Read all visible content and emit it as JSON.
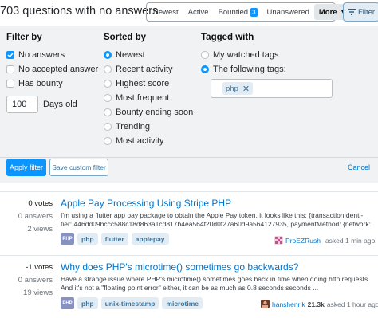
{
  "header": {
    "title": "703 questions with no answers",
    "tabs": [
      {
        "label": "Newest",
        "active": false
      },
      {
        "label": "Active",
        "active": false
      },
      {
        "label": "Bountied",
        "badge": "3",
        "active": false
      },
      {
        "label": "Unanswered",
        "active": false
      },
      {
        "label": "More",
        "active": true
      }
    ],
    "filter_label": "Filter"
  },
  "filter_by": {
    "heading": "Filter by",
    "options": [
      {
        "label": "No answers",
        "checked": true
      },
      {
        "label": "No accepted answer",
        "checked": false
      },
      {
        "label": "Has bounty",
        "checked": false
      }
    ],
    "days_value": "100",
    "days_label": "Days old"
  },
  "sorted_by": {
    "heading": "Sorted by",
    "options": [
      {
        "label": "Newest",
        "selected": true
      },
      {
        "label": "Recent activity",
        "selected": false
      },
      {
        "label": "Highest score",
        "selected": false
      },
      {
        "label": "Most frequent",
        "selected": false
      },
      {
        "label": "Bounty ending soon",
        "selected": false
      },
      {
        "label": "Trending",
        "selected": false
      },
      {
        "label": "Most activity",
        "selected": false
      }
    ]
  },
  "tagged_with": {
    "heading": "Tagged with",
    "options": [
      {
        "label": "My watched tags",
        "selected": false
      },
      {
        "label": "The following tags:",
        "selected": true
      }
    ],
    "tags": [
      "php"
    ]
  },
  "actions": {
    "apply": "Apply filter",
    "save": "Save custom filter",
    "cancel": "Cancel"
  },
  "questions": [
    {
      "votes": "0 votes",
      "answers": "0 answers",
      "views": "2 views",
      "title": "Apple Pay Processing Using Stripe PHP",
      "excerpt": "I'm using a flutter app pay package to obtain the Apple Pay token, it looks like this: {transactionIdenti-fier: 446dd09bccc588c18d863a1cd817b4ea564f20d0f27a60d9a564127935, paymentMethod: {network: ...",
      "tags": [
        "php",
        "flutter",
        "applepay"
      ],
      "user": "ProEZRush",
      "rep": "",
      "asked": "asked 1 min ago",
      "avatar_color": "#d14a8b"
    },
    {
      "votes": "-1 votes",
      "answers": "0 answers",
      "views": "19 views",
      "title": "Why does PHP's microtime() sometimes go backwards?",
      "excerpt": "Have a strange issue where PHP's microtime() sometimes goes back in time when doing http requests. And it's not a \"floating point error\" either, it can be as much as 0.8 seconds seconds ...",
      "tags": [
        "php",
        "unix-timestamp",
        "microtime"
      ],
      "user": "hanshenrik",
      "rep": "21.3k",
      "asked": "asked 1 hour ago",
      "avatar_color": "#c0392b"
    }
  ]
}
